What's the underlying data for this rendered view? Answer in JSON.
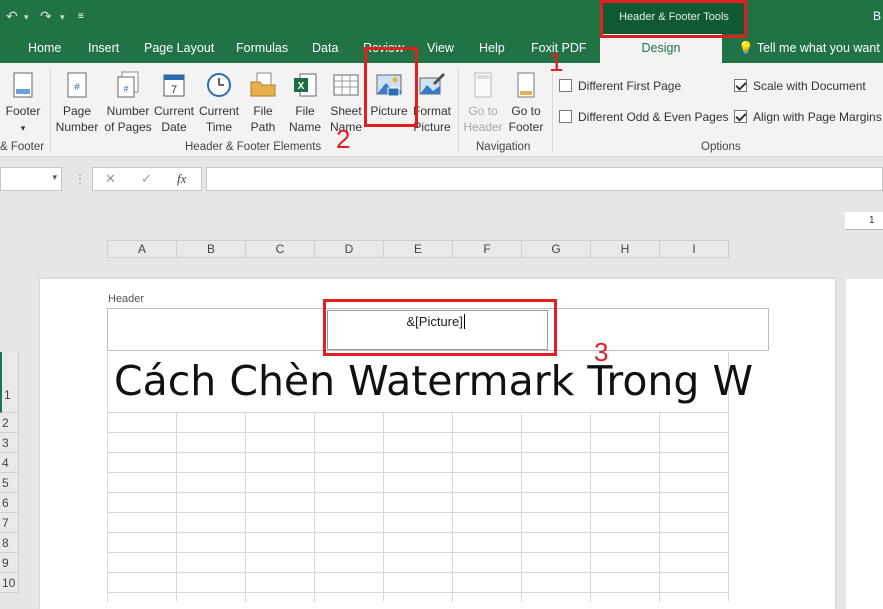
{
  "window": {
    "context_title": "Header & Footer Tools",
    "title_partial": "B"
  },
  "tabs": [
    "Home",
    "Insert",
    "Page Layout",
    "Formulas",
    "Data",
    "Review",
    "View",
    "Help",
    "Foxit PDF"
  ],
  "context_tab": "Design",
  "tell_me": "Tell me what you want t",
  "ribbon": {
    "footer_label": "Footer",
    "buttons": [
      {
        "line1": "Page",
        "line2": "Number"
      },
      {
        "line1": "Number",
        "line2": "of Pages"
      },
      {
        "line1": "Current",
        "line2": "Date"
      },
      {
        "line1": "Current",
        "line2": "Time"
      },
      {
        "line1": "File",
        "line2": "Path"
      },
      {
        "line1": "File",
        "line2": "Name"
      },
      {
        "line1": "Sheet",
        "line2": "Name"
      },
      {
        "line1": "Picture",
        "line2": ""
      },
      {
        "line1": "Format",
        "line2": "Picture"
      },
      {
        "line1": "Go to",
        "line2": "Header"
      },
      {
        "line1": "Go to",
        "line2": "Footer"
      }
    ],
    "groups": {
      "hf_partial": "& Footer",
      "elements": "Header & Footer Elements",
      "navigation": "Navigation",
      "options": "Options"
    },
    "options": {
      "different_first_page": {
        "label": "Different First Page",
        "checked": false
      },
      "different_odd_even": {
        "label": "Different Odd & Even Pages",
        "checked": false
      },
      "scale_with_document": {
        "label": "Scale with Document",
        "checked": true
      },
      "align_with_margins": {
        "label": "Align with Page Margins",
        "checked": true
      }
    }
  },
  "formula_bar": {
    "fx": "fx",
    "cancel": "✕",
    "enter": "✓",
    "value": ""
  },
  "columns": [
    "A",
    "B",
    "C",
    "D",
    "E",
    "F",
    "G",
    "H",
    "I"
  ],
  "rows": [
    "1",
    "2",
    "3",
    "4",
    "5",
    "6",
    "7",
    "8",
    "9",
    "10"
  ],
  "ruler_mark": "1",
  "sheet": {
    "header_label": "Header",
    "header_center": "&[Picture]",
    "cell_a1": "Cách Chèn Watermark Trong W"
  },
  "annotations": {
    "step1": "1",
    "step2": "2",
    "step3": "3",
    "color": "#e02020"
  }
}
